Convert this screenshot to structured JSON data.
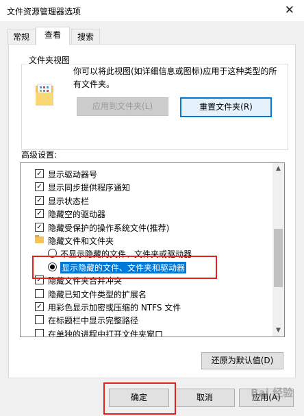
{
  "window": {
    "title": "文件资源管理器选项",
    "close_symbol": "✕"
  },
  "tabs": [
    {
      "label": "常规",
      "active": false
    },
    {
      "label": "查看",
      "active": true
    },
    {
      "label": "搜索",
      "active": false
    }
  ],
  "folder_views": {
    "label": "文件夹视图",
    "description": "你可以将此视图(如详细信息或图标)应用于这种类型的所有文件夹。",
    "apply_button": "应用到文件夹(L)",
    "reset_button": "重置文件夹(R)"
  },
  "advanced": {
    "label": "高级设置:",
    "rows": [
      {
        "type": "checkbox",
        "checked": true,
        "label": "显示驱动器号"
      },
      {
        "type": "checkbox",
        "checked": true,
        "label": "显示同步提供程序通知"
      },
      {
        "type": "checkbox",
        "checked": true,
        "label": "显示状态栏"
      },
      {
        "type": "checkbox",
        "checked": true,
        "label": "隐藏空的驱动器"
      },
      {
        "type": "checkbox",
        "checked": true,
        "label": "隐藏受保护的操作系统文件(推荐)"
      },
      {
        "type": "folder",
        "label": "隐藏文件和文件夹"
      },
      {
        "type": "radio",
        "checked": false,
        "label": "不显示隐藏的文件、文件夹或驱动器"
      },
      {
        "type": "radio",
        "checked": true,
        "label": "显示隐藏的文件、文件夹和驱动器",
        "selected": true
      },
      {
        "type": "checkbox",
        "checked": true,
        "label": "隐藏文件夹合并冲突"
      },
      {
        "type": "checkbox",
        "checked": false,
        "label": "隐藏已知文件类型的扩展名"
      },
      {
        "type": "checkbox",
        "checked": true,
        "label": "用彩色显示加密或压缩的 NTFS 文件"
      },
      {
        "type": "checkbox",
        "checked": false,
        "label": "在标题栏中显示完整路径"
      },
      {
        "type": "checkbox",
        "checked": false,
        "label": "在单独的进程中打开文件夹窗口"
      }
    ],
    "restore_button": "还原为默认值(D)"
  },
  "footer": {
    "ok": "确定",
    "cancel": "取消",
    "apply": "应用(A)"
  },
  "watermark": "Bai 经验",
  "colors": {
    "selection": "#0078d7",
    "highlight_box": "#e0231f",
    "focus_border": "#0078d7"
  }
}
